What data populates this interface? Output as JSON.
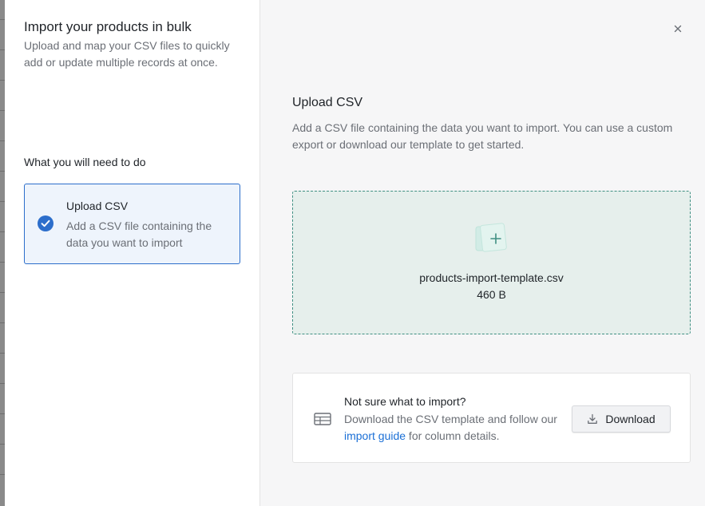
{
  "sidebar": {
    "title": "Import your products in bulk",
    "description": "Upload and map your CSV files to quickly add or update multiple records at once.",
    "section_title": "What you will need to do",
    "steps": [
      {
        "title": "Upload CSV",
        "description": "Add a CSV file containing the data you want to import",
        "icon": "check-circle-icon",
        "status": "active"
      }
    ]
  },
  "main": {
    "close_icon": "close-icon",
    "title": "Upload CSV",
    "description": "Add a CSV file containing the data you want to import. You can use a custom export or download our template to get started.",
    "dropzone": {
      "icon": "file-add-icon",
      "file_name": "products-import-template.csv",
      "file_size": "460 B"
    },
    "help": {
      "icon": "table-icon",
      "title": "Not sure what to import?",
      "text_before": "Download the CSV template and follow our ",
      "link": "import guide",
      "text_after": " for column details.",
      "button_label": "Download",
      "button_icon": "download-icon"
    }
  },
  "colors": {
    "accent": "#2c6ecb",
    "link": "#1a6fd6",
    "dropzone_border": "#3f8f82",
    "dropzone_bg": "#e6efec"
  }
}
